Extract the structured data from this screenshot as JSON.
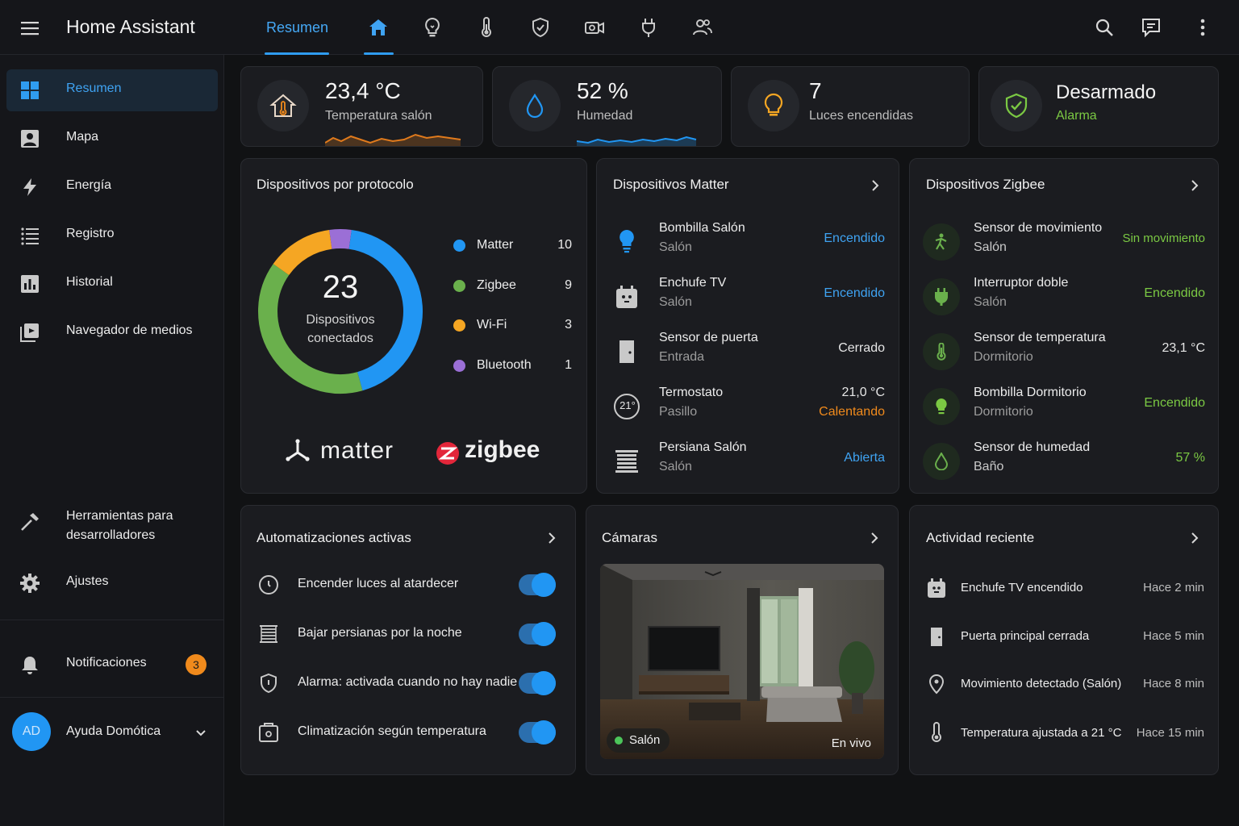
{
  "app": {
    "title": "Home Assistant"
  },
  "topbar": {
    "active_tab_label": "Resumen",
    "tab_icons": [
      "home-icon",
      "lightbulb-icon",
      "thermometer-icon",
      "shield-icon",
      "camera-icon",
      "plug-icon",
      "people-icon"
    ],
    "actions": [
      "search-icon",
      "assist-icon",
      "more-vert-icon"
    ]
  },
  "sidebar": {
    "items": [
      {
        "label": "Resumen",
        "icon": "dashboard-icon",
        "active": true
      },
      {
        "label": "Mapa",
        "icon": "map-icon"
      },
      {
        "label": "Energía",
        "icon": "lightning-icon"
      },
      {
        "label": "Registro",
        "icon": "list-icon"
      },
      {
        "label": "Historial",
        "icon": "chart-box-icon"
      },
      {
        "label": "Navegador de medios",
        "icon": "media-icon"
      }
    ],
    "bottom_items": [
      {
        "label": "Herramientas para desarrolladores",
        "icon": "hammer-icon"
      },
      {
        "label": "Ajustes",
        "icon": "gear-icon"
      }
    ],
    "notifications": {
      "label": "Notificaciones",
      "count": "3",
      "icon": "bell-icon"
    },
    "user": {
      "initials": "AD",
      "name": "Ayuda Domótica"
    }
  },
  "stats": [
    {
      "value": "23,4 °C",
      "label": "Temperatura salón",
      "icon": "home-thermometer-icon",
      "accent": "#f08a1c"
    },
    {
      "value": "52 %",
      "label": "Humedad",
      "icon": "water-drop-icon",
      "accent": "#2196f3"
    },
    {
      "value": "7",
      "label": "Luces encendidas",
      "icon": "lightbulb-icon",
      "accent": "#f5a623"
    },
    {
      "value": "Desarmado",
      "label": "Alarma",
      "icon": "shield-check-icon",
      "accent": "#7bc943"
    }
  ],
  "protocols": {
    "title": "Dispositivos por protocolo",
    "total": "23",
    "total_label_line1": "Dispositivos",
    "total_label_line2": "conectados",
    "items": [
      {
        "name": "Matter",
        "count": 10,
        "color": "#2196f3"
      },
      {
        "name": "Zigbee",
        "count": 9,
        "color": "#6ab04c"
      },
      {
        "name": "Wi-Fi",
        "count": 3,
        "color": "#f5a623"
      },
      {
        "name": "Bluetooth",
        "count": 1,
        "color": "#9b6fd6"
      }
    ],
    "logos": {
      "matter": "matter",
      "zigbee": "zigbee"
    }
  },
  "matter": {
    "title": "Dispositivos Matter",
    "devices": [
      {
        "name": "Bombilla Salón",
        "room": "Salón",
        "state": "Encendido",
        "state_color": "#3fa3f2",
        "icon": "lightbulb-icon"
      },
      {
        "name": "Enchufe TV",
        "room": "Salón",
        "state": "Encendido",
        "state_color": "#3fa3f2",
        "icon": "outlet-icon"
      },
      {
        "name": "Sensor de puerta",
        "room": "Entrada",
        "state": "Cerrado",
        "state_color": "#e6e6e6",
        "icon": "door-icon"
      },
      {
        "name": "Termostato",
        "room": "Pasillo",
        "state": "21,0 °C",
        "state2": "Calentando",
        "state_color": "#e6e6e6",
        "state2_color": "#f08a1c",
        "icon": "thermostat-icon",
        "badge": "21°"
      },
      {
        "name": "Persiana Salón",
        "room": "Salón",
        "state": "Abierta",
        "state_color": "#3fa3f2",
        "icon": "blinds-icon"
      }
    ]
  },
  "zigbee": {
    "title": "Dispositivos Zigbee",
    "devices": [
      {
        "name": "Sensor de movimiento",
        "room": "Salón",
        "state": "Sin movimiento",
        "state_color": "#7bc943",
        "icon": "motion-icon"
      },
      {
        "name": "Interruptor doble",
        "room": "Salón",
        "state": "Encendido",
        "state_color": "#7bc943",
        "icon": "plug-icon"
      },
      {
        "name": "Sensor de temperatura",
        "room": "Dormitorio",
        "state": "23,1 °C",
        "state_color": "#e6e6e6",
        "icon": "thermometer-icon"
      },
      {
        "name": "Bombilla Dormitorio",
        "room": "Dormitorio",
        "state": "Encendido",
        "state_color": "#7bc943",
        "icon": "lightbulb-icon"
      },
      {
        "name": "Sensor de humedad",
        "room": "Baño",
        "state": "57 %",
        "state_color": "#7bc943",
        "icon": "water-drop-icon"
      }
    ]
  },
  "automations": {
    "title": "Automatizaciones activas",
    "items": [
      {
        "label": "Encender luces al atardecer",
        "enabled": true,
        "icon": "clock-icon"
      },
      {
        "label": "Bajar persianas por la noche",
        "enabled": true,
        "icon": "blinds-icon"
      },
      {
        "label": "Alarma: activada cuando no hay nadie",
        "enabled": true,
        "icon": "shield-icon"
      },
      {
        "label": "Climatización según temperatura",
        "enabled": true,
        "icon": "thermostat-box-icon"
      }
    ]
  },
  "cameras": {
    "title": "Cámaras",
    "feed": {
      "name": "Salón",
      "status": "En vivo"
    }
  },
  "activity": {
    "title": "Actividad reciente",
    "items": [
      {
        "label": "Enchufe TV encendido",
        "time": "Hace 2 min",
        "icon": "outlet-icon"
      },
      {
        "label": "Puerta principal cerrada",
        "time": "Hace 5 min",
        "icon": "door-icon"
      },
      {
        "label": "Movimiento detectado (Salón)",
        "time": "Hace 8 min",
        "icon": "location-icon"
      },
      {
        "label": "Temperatura ajustada a 21 °C",
        "time": "Hace 15 min",
        "icon": "thermometer-icon"
      }
    ]
  }
}
